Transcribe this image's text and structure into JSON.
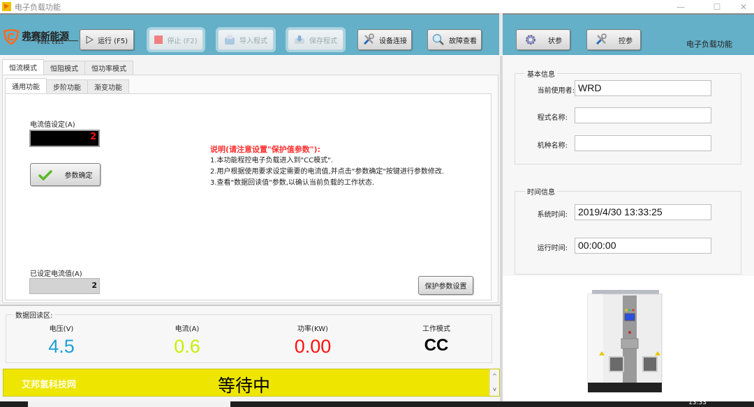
{
  "window": {
    "title": "电子负载功能",
    "controls": [
      "minimize",
      "maximize",
      "close"
    ]
  },
  "toolbar": {
    "logo": {
      "brand": "弗赛新能源",
      "sub": "FUEL CELL"
    },
    "buttons": [
      {
        "label": "运行 (F5)",
        "icon": "play-icon",
        "enabled": true
      },
      {
        "label": "停止 (F2)",
        "icon": "stop-icon",
        "enabled": false
      },
      {
        "label": "导入程式",
        "icon": "import-icon",
        "enabled": false
      },
      {
        "label": "保存程式",
        "icon": "save-icon",
        "enabled": false
      },
      {
        "label": "设备连接",
        "icon": "tools-icon",
        "enabled": true
      },
      {
        "label": "故障查看",
        "icon": "magnifier-icon",
        "enabled": true
      }
    ],
    "right_buttons": [
      {
        "label": "状参",
        "icon": "gear-icon"
      },
      {
        "label": "控参",
        "icon": "tools-icon"
      }
    ],
    "right_title": "电子负载功能"
  },
  "mode_tabs": [
    {
      "label": "恒流模式",
      "active": true
    },
    {
      "label": "恒阻模式",
      "active": false
    },
    {
      "label": "恒功率模式",
      "active": false
    }
  ],
  "function_tabs": [
    {
      "label": "通用功能",
      "active": true
    },
    {
      "label": "步阶功能",
      "active": false
    },
    {
      "label": "渐变功能",
      "active": false
    }
  ],
  "cc_panel": {
    "current_setting_label": "电流值设定(A)",
    "current_setting_value": "2",
    "confirm_button": "参数确定",
    "set_current_label": "已设定电流值(A)",
    "set_current_value": "2",
    "protect_button": "保护参数设置",
    "note": {
      "heading": "说明(请注意设置\"保护值参数\"):",
      "lines": [
        "1.本功能程控电子负载进入到\"CC模式\".",
        "2.用户根据使用要求设定需要的电流值,并点击\"参数确定\"按键进行参数修改.",
        "3.查看\"数据回读值\"参数,以确认当前负载的工作状态."
      ]
    }
  },
  "readback": {
    "title": "数据回读区:",
    "items": [
      {
        "label": "电压(V)",
        "value": "4.5",
        "color": "#1ea0d8"
      },
      {
        "label": "电流(A)",
        "value": "0.6",
        "color": "#c8f000"
      },
      {
        "label": "功率(KW)",
        "value": "0.00",
        "color": "#ff1010"
      },
      {
        "label": "工作模式",
        "value": "CC",
        "color": "#000000"
      }
    ]
  },
  "status_bar": {
    "watermark": "艾邦氢科技网",
    "text": "等待中",
    "color": "#eee600"
  },
  "basic_info": {
    "title": "基本信息",
    "fields": [
      {
        "label": "当前使用者:",
        "value": "WRD"
      },
      {
        "label": "程式名称:",
        "value": ""
      },
      {
        "label": "机种名称:",
        "value": ""
      }
    ]
  },
  "time_info": {
    "title": "时间信息",
    "fields": [
      {
        "label": "系统时间:",
        "value": "2019/4/30 13:33:25"
      },
      {
        "label": "运行时间:",
        "value": "00:00:00"
      }
    ]
  },
  "taskbar": {
    "clock": "13:33"
  }
}
